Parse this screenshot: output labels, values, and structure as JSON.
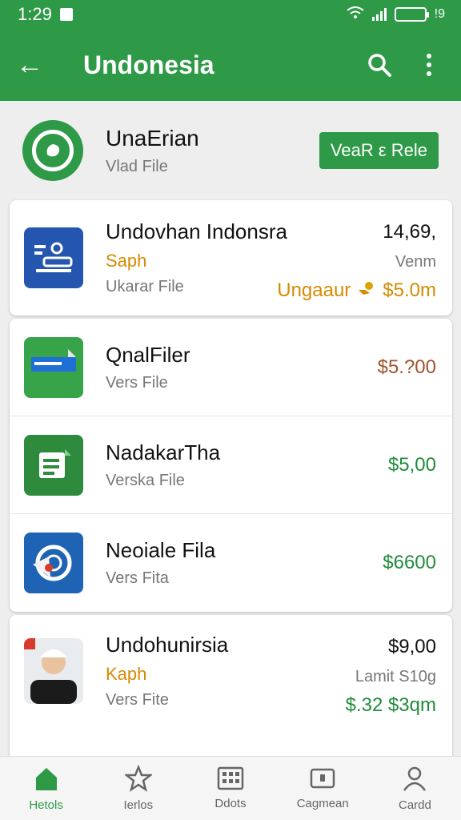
{
  "status": {
    "time": "1:29",
    "battery_label": "!9",
    "battery_level": 0.85
  },
  "appbar": {
    "title": "Undonesia"
  },
  "header": {
    "name": "UnaErian",
    "subtitle": "Vlad File",
    "action_label": "VeaR ε Rele"
  },
  "colors": {
    "brand_green": "#2e9a47",
    "accent_orange": "#d68a00",
    "price_green": "#1f8c3c",
    "price_brown": "#a0522d"
  },
  "card1": {
    "title": "Undovhan Indonsra",
    "tag": "Saph",
    "subtitle": "Ukarar File",
    "right_top": "14,69,",
    "right_mid": "Venm",
    "right_bottom_label": "Ungaaur",
    "right_bottom_price": "$5.0m"
  },
  "list": [
    {
      "title": "QnalFiler",
      "subtitle": "Vers File",
      "price": "$5.?00",
      "icon": "file-doc-icon"
    },
    {
      "title": "NadakarTha",
      "subtitle": "Verska File",
      "price": "$5,00",
      "icon": "sheet-icon"
    },
    {
      "title": "Neoiale Fila",
      "subtitle": "Vers Fita",
      "price": "$6600",
      "icon": "radar-icon"
    }
  ],
  "card3": {
    "title": "Undohunirsia",
    "tag": "Kaph",
    "subtitle": "Vers Fite",
    "right_top": "$9,00",
    "right_mid": "Lamit S10g",
    "right_bottom": "$.32 $3qm"
  },
  "nav": [
    {
      "label": "Hetols",
      "icon": "home-icon",
      "active": true
    },
    {
      "label": "Ierlos",
      "icon": "star-icon",
      "active": false
    },
    {
      "label": "Ddots",
      "icon": "grid-icon",
      "active": false
    },
    {
      "label": "Cagmean",
      "icon": "wallet-icon",
      "active": false
    },
    {
      "label": "Cardd",
      "icon": "profile-icon",
      "active": false
    }
  ]
}
